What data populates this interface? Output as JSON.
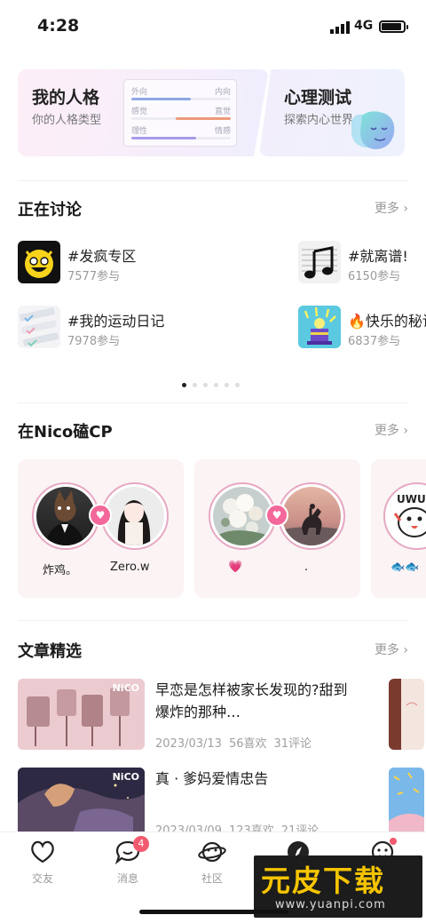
{
  "status": {
    "time": "4:28",
    "network": "4G"
  },
  "personality": {
    "title": "我的人格",
    "subtitle": "你的人格类型",
    "traits": [
      {
        "left": "外向",
        "right": "内向",
        "color": "#8fa8e6",
        "level": 0.6
      },
      {
        "left": "感觉",
        "right": "直觉",
        "color": "#ee9a7a",
        "level": 0.55
      },
      {
        "left": "理性",
        "right": "情感",
        "color": "#a89be8",
        "level": 0.65
      }
    ]
  },
  "psych": {
    "title": "心理测试",
    "subtitle": "探索内心世界"
  },
  "discuss": {
    "title": "正在讨论",
    "more": "更多",
    "topics": [
      {
        "name": "#发疯专区",
        "count": "7577参与"
      },
      {
        "name": "#就离谱!",
        "count": "6150参与"
      },
      {
        "name": "#我的运动日记",
        "count": "7978参与"
      },
      {
        "name": "🔥快乐的秘诀",
        "count": "6837参与"
      }
    ],
    "page": 1,
    "pages": 6
  },
  "cp": {
    "title": "在Nico磕CP",
    "more": "更多",
    "pairs": [
      {
        "name_a": "炸鸡。",
        "name_b": "Zero.w"
      },
      {
        "name_a": "💗",
        "name_b": "."
      },
      {
        "name_a": "🐟🐟"
      }
    ]
  },
  "articles": {
    "title": "文章精选",
    "more": "更多",
    "items": [
      {
        "title": "早恋是怎样被家长发现的?甜到爆炸的那种…",
        "date": "2023/03/13",
        "likes": "56喜欢",
        "comments": "31评论",
        "logo": "NiCO"
      },
      {
        "title": "真 · 爹妈爱情忠告",
        "date": "2023/03/09",
        "likes": "123喜欢",
        "comments": "21评论",
        "logo": "NiCO"
      }
    ]
  },
  "tabs": [
    {
      "label": "交友"
    },
    {
      "label": "消息",
      "badge": "4"
    },
    {
      "label": "社区"
    },
    {
      "label": ""
    },
    {
      "label": ""
    }
  ],
  "watermark": {
    "big": "元皮下载",
    "url": "www.yuanpi.com"
  },
  "colors": {
    "accent": "#f4679a",
    "badge": "#f25a6f"
  }
}
